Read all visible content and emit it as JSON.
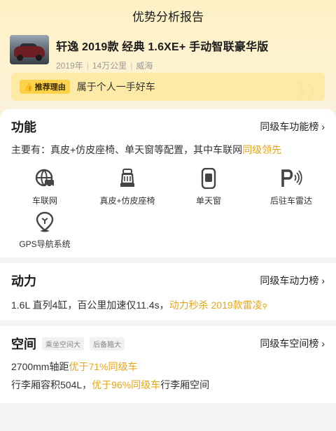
{
  "page": {
    "title": "优势分析报告"
  },
  "car": {
    "name": "轩逸 2019款 经典 1.6XE+ 手动智联豪华版",
    "year": "2019年",
    "mileage": "14万公里",
    "city": "威海"
  },
  "reason": {
    "badge": "推荐理由",
    "text": "属于个人一手好车"
  },
  "function": {
    "title": "功能",
    "link": "同级车功能榜",
    "summary_prefix": "主要有：真皮+仿皮座椅、单天窗等配置，其中车联网",
    "summary_highlight": "同级领先",
    "features": [
      {
        "label": "车联网",
        "icon": "connected-car-icon"
      },
      {
        "label": "真皮+仿皮座椅",
        "icon": "seat-icon"
      },
      {
        "label": "单天窗",
        "icon": "sunroof-icon"
      },
      {
        "label": "后驻车雷达",
        "icon": "parking-radar-icon"
      },
      {
        "label": "GPS导航系统",
        "icon": "gps-icon"
      }
    ]
  },
  "power": {
    "title": "动力",
    "link": "同级车动力榜",
    "text": "1.6L 直列4缸，百公里加速仅11.4s，",
    "highlight": "动力秒杀 2019款雷凌"
  },
  "space": {
    "title": "空间",
    "link": "同级车空间榜",
    "tags": [
      "乘坐空间大",
      "后备箱大"
    ],
    "line1_prefix": "2700mm轴距",
    "line1_highlight": "优于71%同级车",
    "line2_prefix": "行李厢容积504L，",
    "line2_highlight": "优于96%同级车",
    "line2_suffix": "行李厢空间"
  },
  "colors": {
    "accent": "#e3a618",
    "badge": "#fbd24a",
    "banner": "#fdeaa6"
  }
}
